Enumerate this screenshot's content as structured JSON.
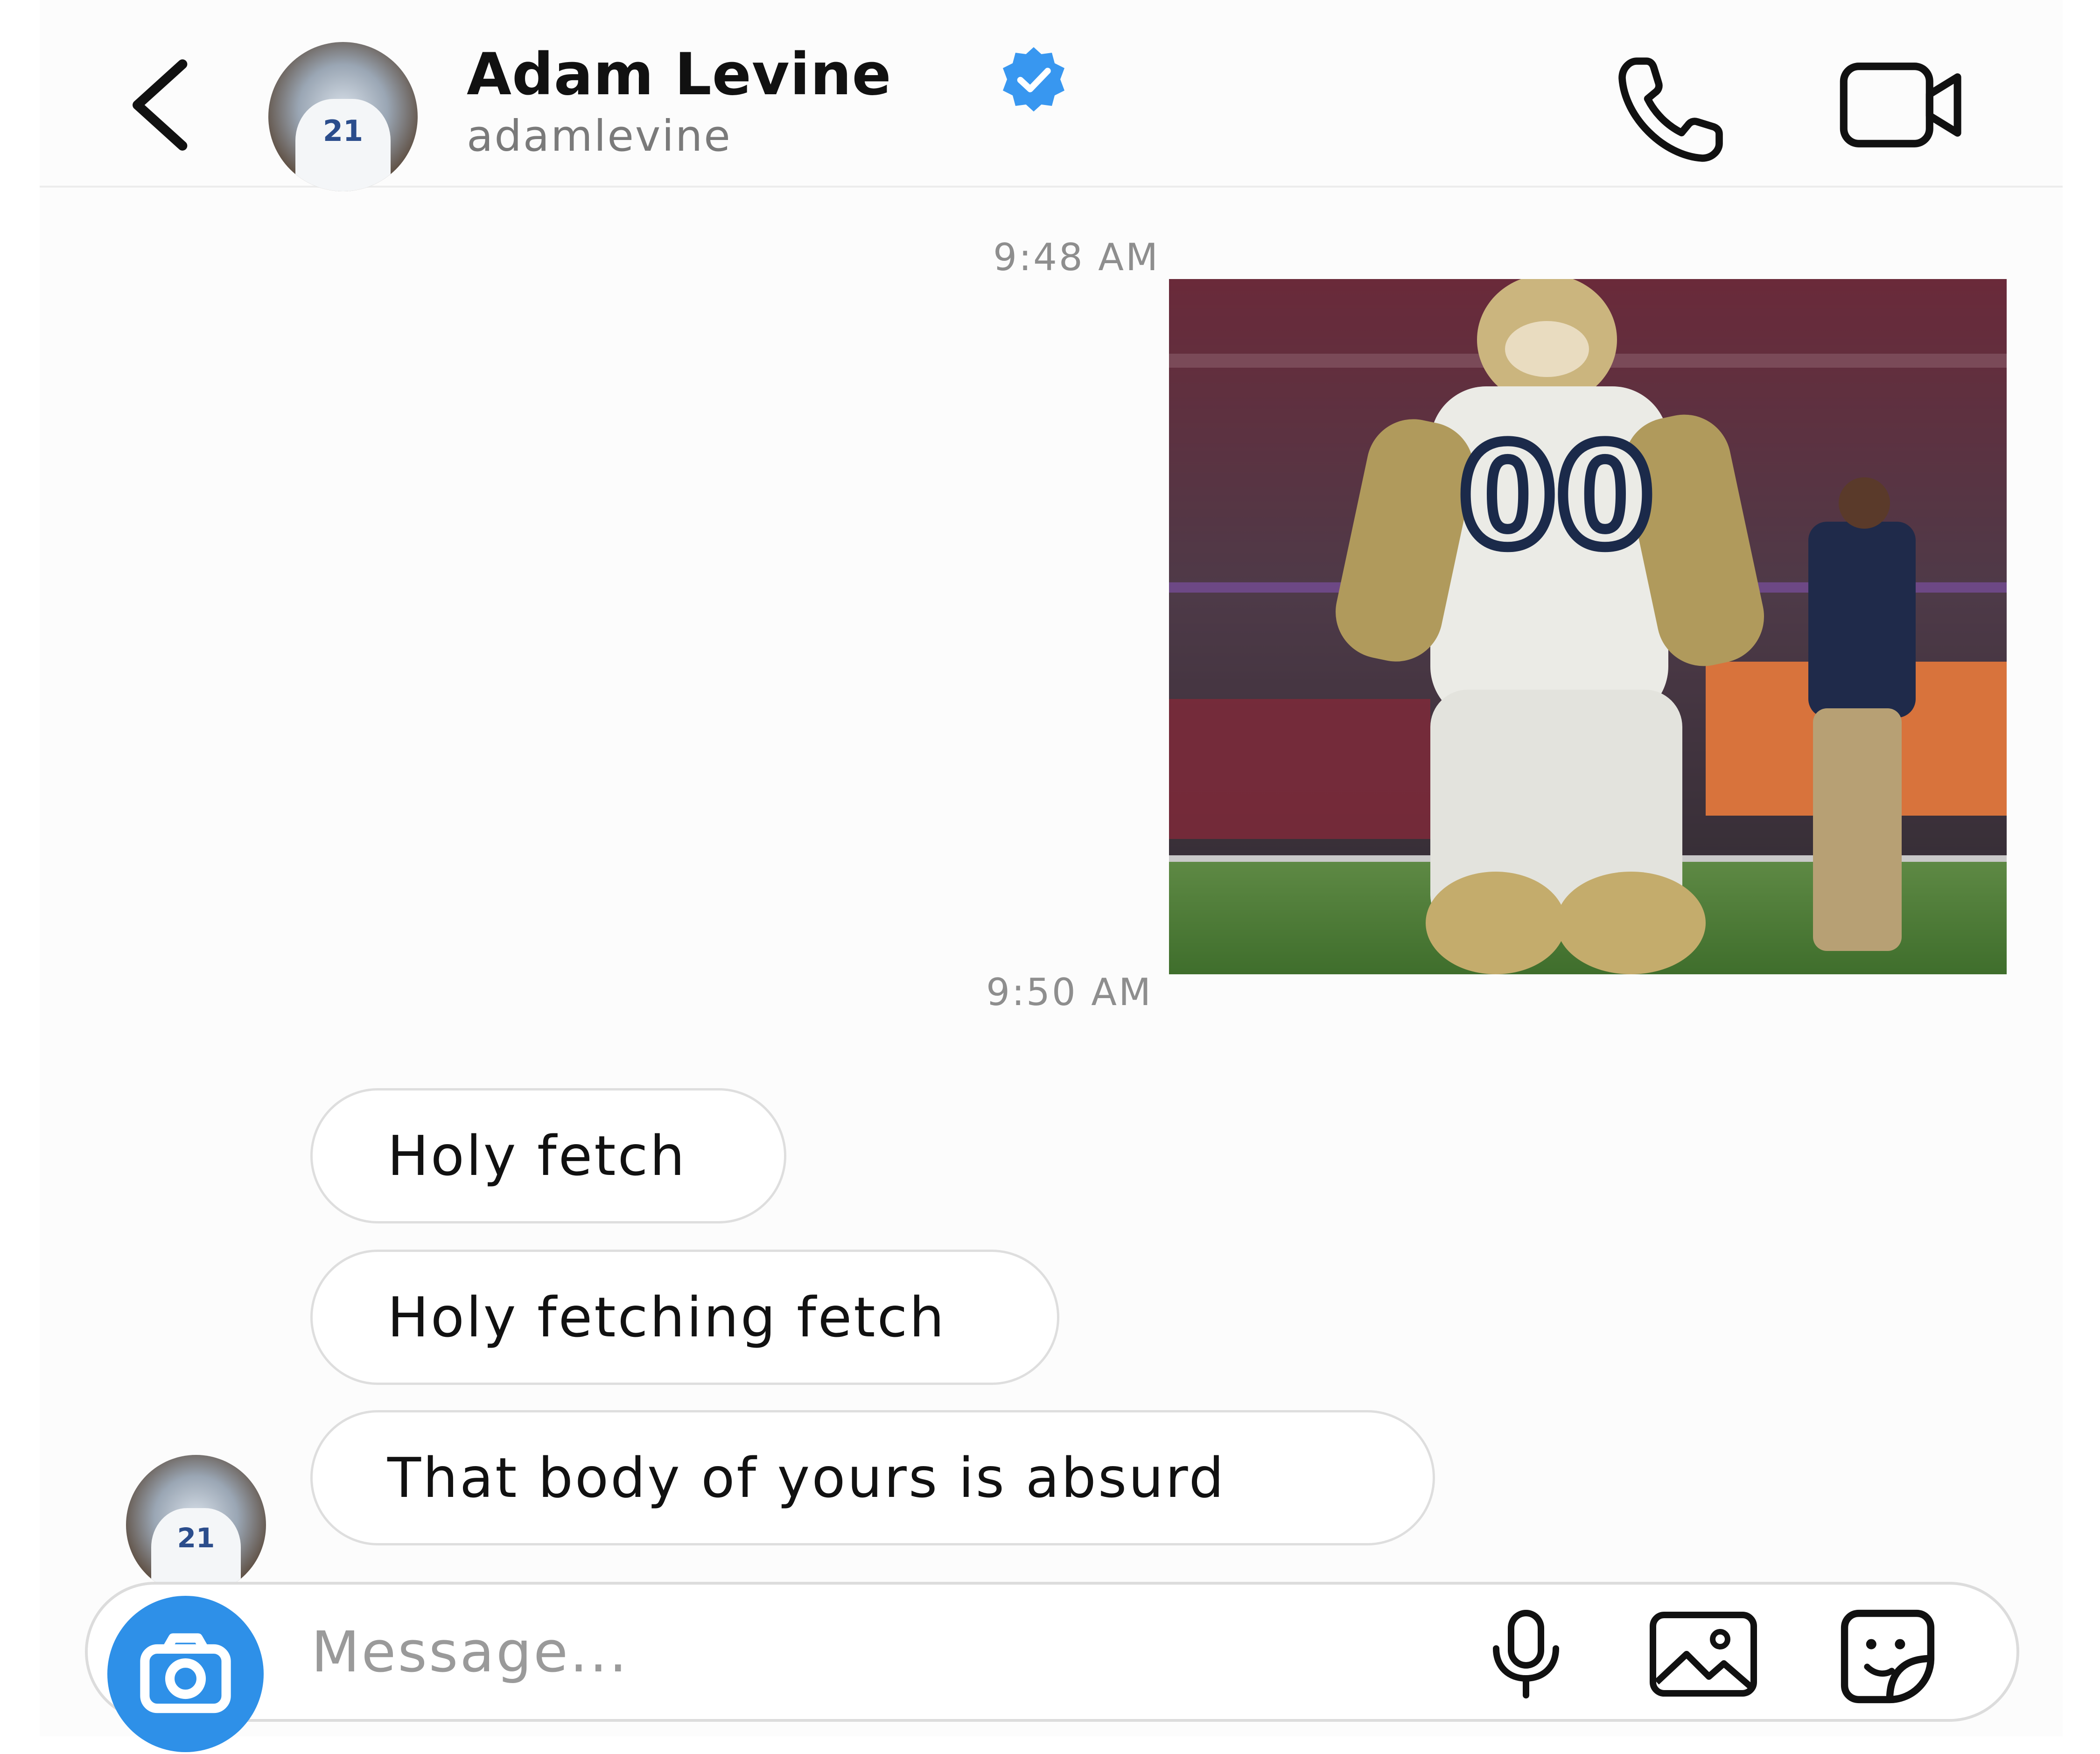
{
  "header": {
    "name": "Adam Levine",
    "username": "adamlevine",
    "avatar_jersey_number": "21",
    "verified_color": "#3897f0"
  },
  "messages": {
    "timestamp_1": "9:48 AM",
    "timestamp_2": "9:50 AM",
    "photo": {
      "jersey_number": "00",
      "description_icon": "mascot-photo"
    },
    "bubbles": [
      "Holy fetch",
      "Holy fetching fetch",
      "That body of yours is absurd"
    ]
  },
  "composer": {
    "placeholder": "Message...",
    "camera_button_color": "#2e90e8"
  }
}
